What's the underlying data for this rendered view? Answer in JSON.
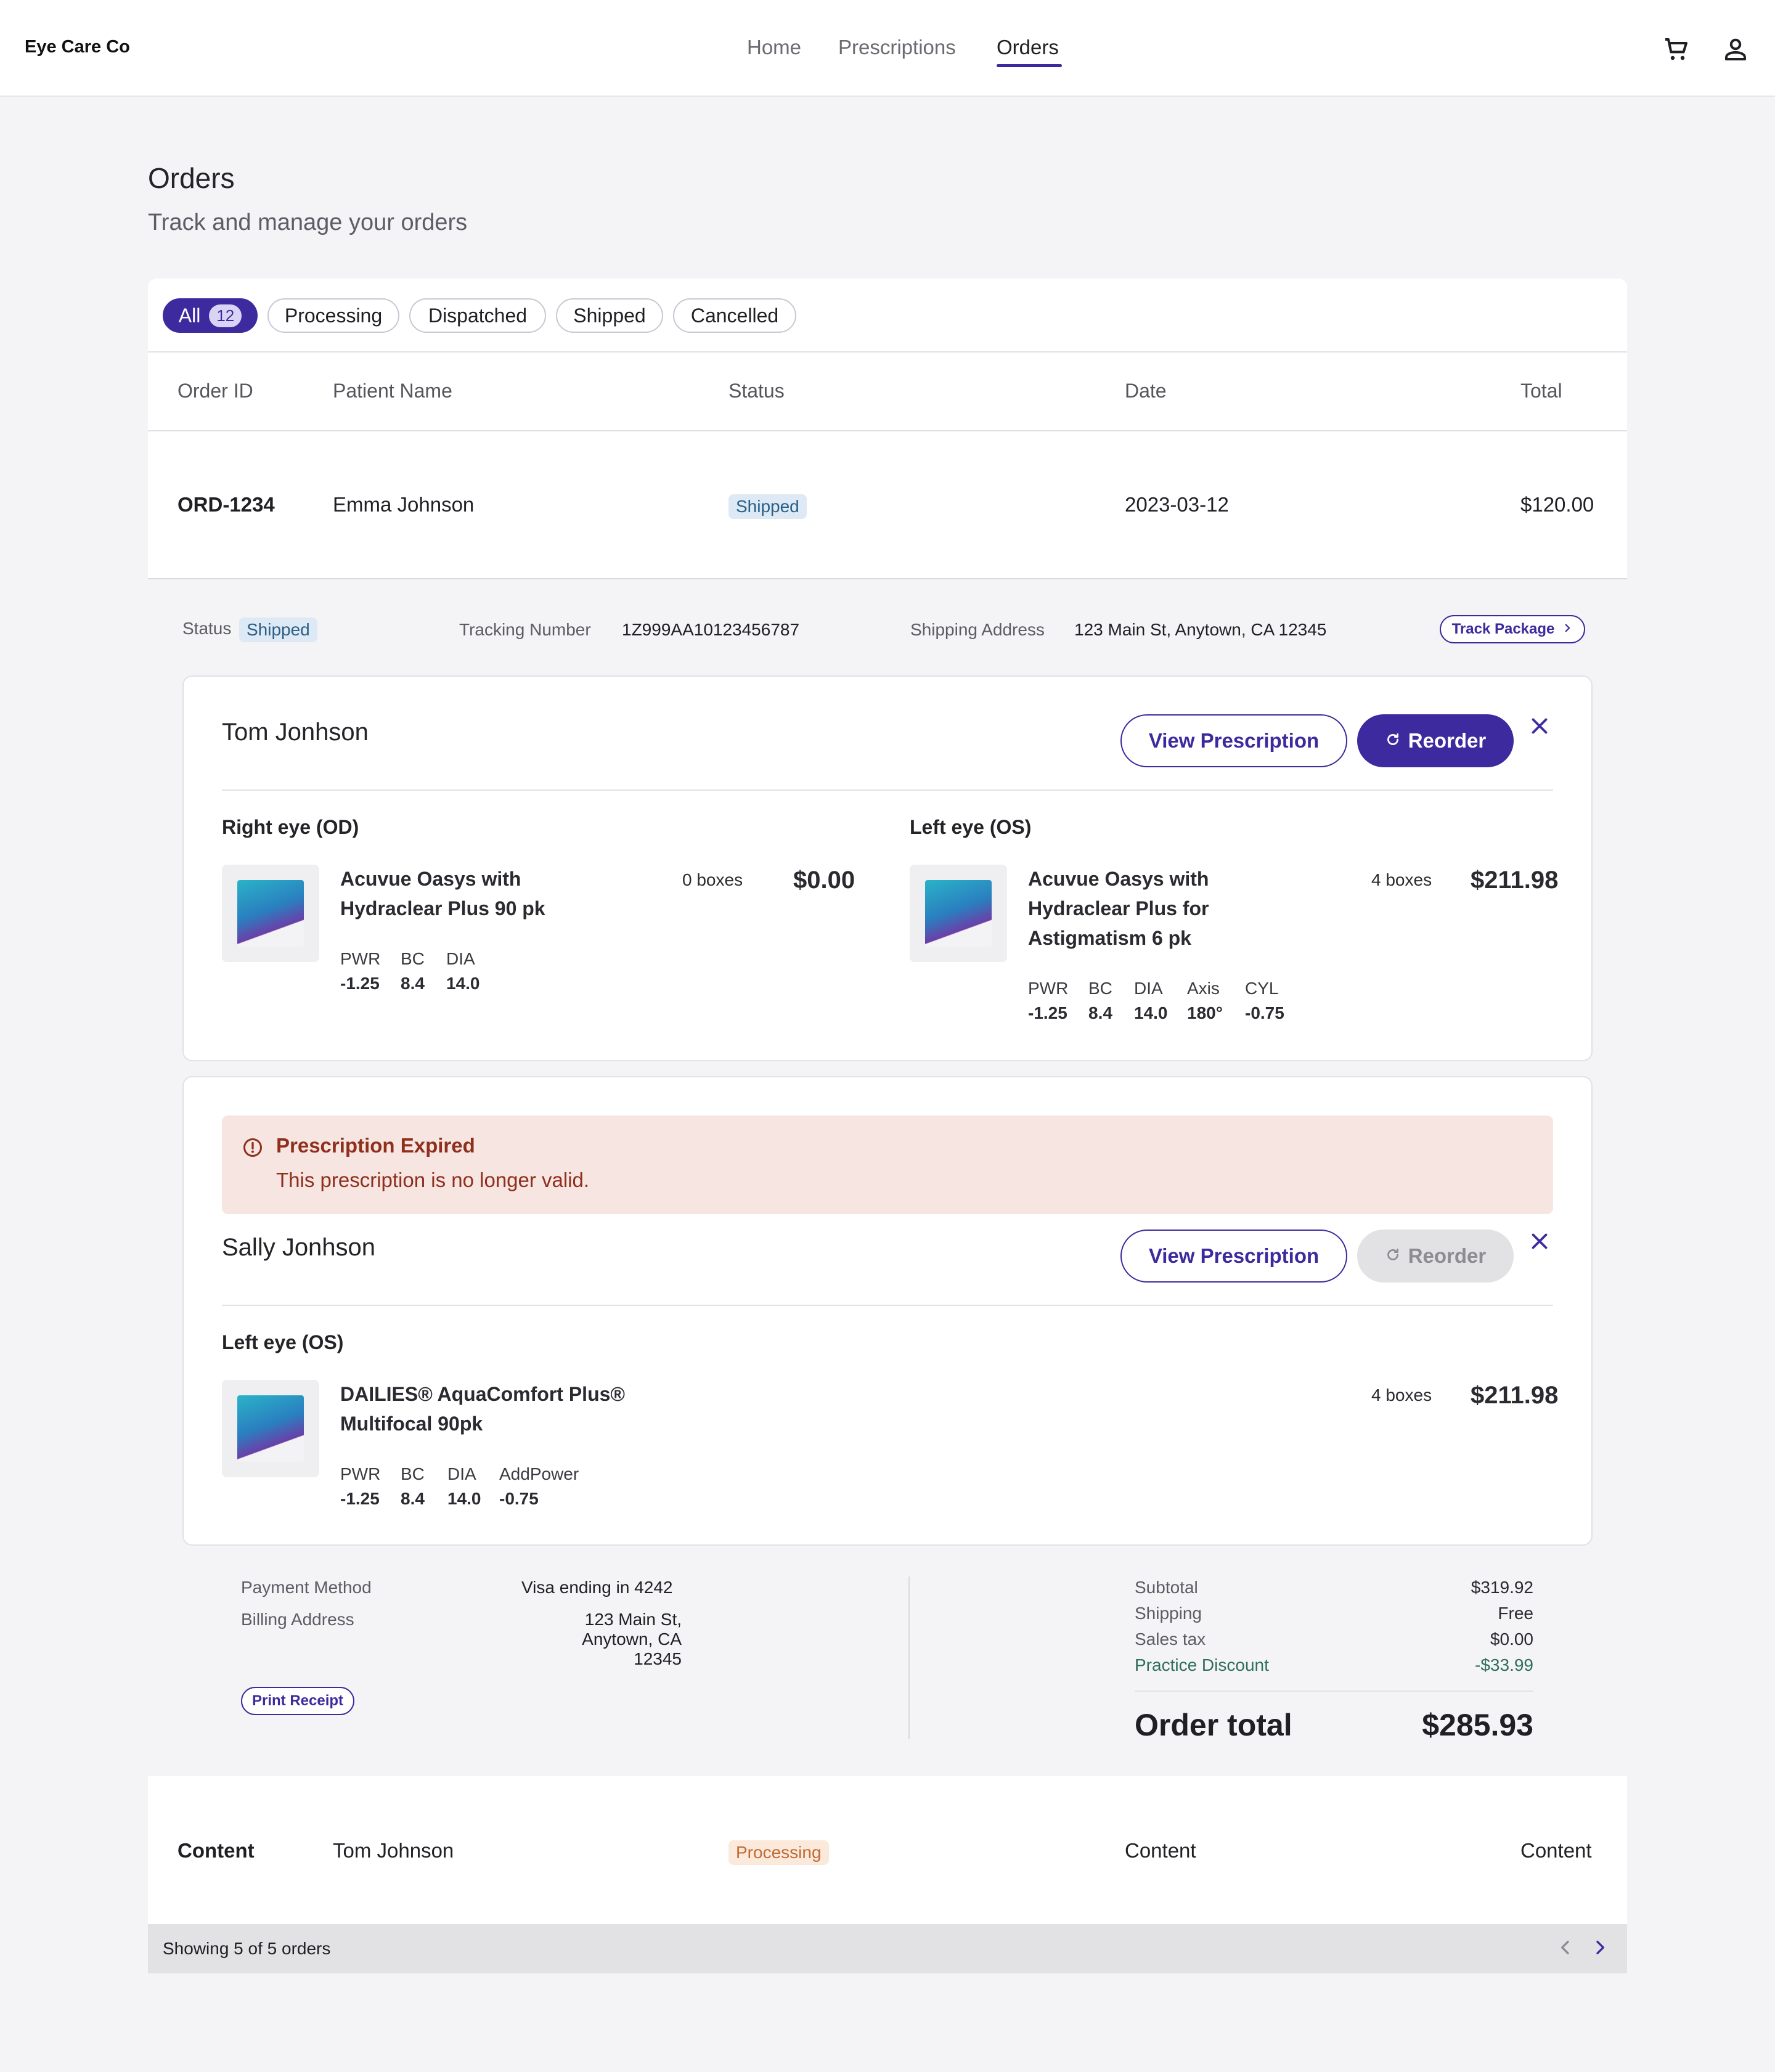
{
  "header": {
    "brand": "Eye Care Co",
    "nav": [
      "Home",
      "Prescriptions",
      "Orders"
    ]
  },
  "page": {
    "title": "Orders",
    "subtitle": "Track and manage your orders"
  },
  "filters": {
    "all_label": "All",
    "all_count": "12",
    "chips": [
      "Processing",
      "Dispatched",
      "Shipped",
      "Cancelled"
    ]
  },
  "table": {
    "columns": [
      "Order ID",
      "Patient Name",
      "Status",
      "Date",
      "Total"
    ],
    "rows": [
      {
        "id": "ORD-1234",
        "patient": "Emma Johnson",
        "status": "Shipped",
        "date": "2023-03-12",
        "total": "$120.00"
      },
      {
        "id": "Content",
        "patient": "Tom Johnson",
        "status": "Processing",
        "date": "Content",
        "total": "Content"
      }
    ]
  },
  "detail": {
    "status_label": "Status",
    "status_value": "Shipped",
    "tracking_label": "Tracking Number",
    "tracking_value": "1Z999AA10123456787",
    "shipping_label": "Shipping Address",
    "shipping_value": "123 Main St, Anytown, CA 12345",
    "track_button": "Track Package",
    "view_prescription": "View Prescription",
    "reorder": "Reorder",
    "patients": [
      {
        "name": "Tom Jonhson",
        "right": {
          "label": "Right eye (OD)",
          "product_line1": "Acuvue Oasys with",
          "product_line2": "Hydraclear Plus 90 pk",
          "qty": "0 boxes",
          "price": "$0.00",
          "specs": [
            {
              "h": "PWR",
              "v": "-1.25"
            },
            {
              "h": "BC",
              "v": "8.4"
            },
            {
              "h": "DIA",
              "v": "14.0"
            }
          ]
        },
        "left": {
          "label": "Left eye (OS)",
          "product_line1": "Acuvue Oasys with",
          "product_line2": "Hydraclear Plus for",
          "product_line3": "Astigmatism 6 pk",
          "qty": "4 boxes",
          "price": "$211.98",
          "specs": [
            {
              "h": "PWR",
              "v": "-1.25"
            },
            {
              "h": "BC",
              "v": "8.4"
            },
            {
              "h": "DIA",
              "v": "14.0"
            },
            {
              "h": "Axis",
              "v": "180°"
            },
            {
              "h": "CYL",
              "v": "-0.75"
            }
          ]
        }
      },
      {
        "alert_title": "Prescription Expired",
        "alert_message": "This prescription is no longer valid.",
        "name": "Sally Jonhson",
        "left": {
          "label": "Left eye (OS)",
          "product_line1": "DAILIES® AquaComfort Plus®",
          "product_line2": "Multifocal 90pk",
          "qty": "4 boxes",
          "price": "$211.98",
          "specs": [
            {
              "h": "PWR",
              "v": "-1.25"
            },
            {
              "h": "BC",
              "v": "8.4"
            },
            {
              "h": "DIA",
              "v": "14.0"
            },
            {
              "h": "AddPower",
              "v": "-0.75"
            }
          ]
        }
      }
    ],
    "payment": {
      "method_label": "Payment Method",
      "method_value": "Visa ending in 4242",
      "billing_label": "Billing Address",
      "billing_line1": "123 Main St,",
      "billing_line2": "Anytown, CA",
      "billing_line3": "12345",
      "print_button": "Print Receipt"
    },
    "summary": {
      "subtotal_label": "Subtotal",
      "subtotal": "$319.92",
      "shipping_label": "Shipping",
      "shipping": "Free",
      "tax_label": "Sales tax",
      "tax": "$0.00",
      "discount_label": "Practice Discount",
      "discount": "-$33.99",
      "total_label": "Order total",
      "total": "$285.93"
    }
  },
  "footer": {
    "showing": "Showing 5 of 5 orders"
  },
  "colors": {
    "accent": "#3d2a9e",
    "shipped_bg": "#dde9f4",
    "processing_bg": "#fbe9dc",
    "alert_bg": "#f6e5e1"
  }
}
